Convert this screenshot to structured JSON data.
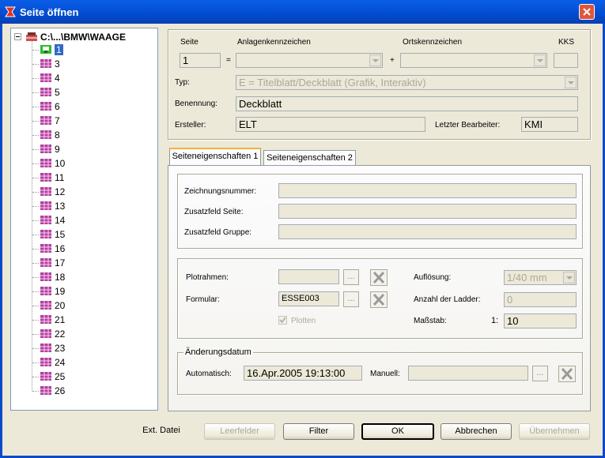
{
  "window": {
    "title": "Seite öffnen",
    "accent": "#0a5de6",
    "close_color": "#e0563b"
  },
  "tree": {
    "root_label": "C:\\...\\BMW\\WAAGE",
    "items": [
      "1",
      "3",
      "4",
      "5",
      "6",
      "7",
      "8",
      "9",
      "10",
      "11",
      "12",
      "13",
      "14",
      "15",
      "16",
      "17",
      "18",
      "19",
      "20",
      "21",
      "22",
      "23",
      "24",
      "25",
      "26"
    ],
    "selected": "1"
  },
  "header": {
    "seite_label": "Seite",
    "seite_value": "1",
    "anlage_label": "Anlagenkennzeichen",
    "eq_sign": "=",
    "plus_sign": "+",
    "ort_label": "Ortskennzeichen",
    "kks_label": "KKS",
    "typ_label": "Typ:",
    "typ_value": "E = Titelblatt/Deckblatt  (Grafik, Interaktiv)",
    "benennung_label": "Benennung:",
    "benennung_value": "Deckblatt",
    "ersteller_label": "Ersteller:",
    "ersteller_value": "ELT",
    "bearbeiter_label": "Letzter Bearbeiter:",
    "bearbeiter_value": "KMI"
  },
  "tabs": [
    {
      "label": "Seiteneigenschaften 1",
      "active": true
    },
    {
      "label": "Seiteneigenschaften 2",
      "active": false
    }
  ],
  "props": {
    "zeichnung_label": "Zeichnungsnummer:",
    "zusatz_seite_label": "Zusatzfeld Seite:",
    "zusatz_gruppe_label": "Zusatzfeld Gruppe:",
    "plotrahmen_label": "Plotrahmen:",
    "formular_label": "Formular:",
    "formular_value": "ESSE003",
    "plotten_label": "Plotten",
    "browse_label": "...",
    "aufloesung_label": "Auflösung:",
    "aufloesung_value": "1/40 mm",
    "ladder_label": "Anzahl der Ladder:",
    "ladder_value": "0",
    "massstab_label": "Maßstab:",
    "massstab_prefix": "1:",
    "massstab_value": "10"
  },
  "aenderung": {
    "group_label": "Änderungsdatum",
    "auto_label": "Automatisch:",
    "auto_value": "16.Apr.2005 19:13:00",
    "manuell_label": "Manuell:"
  },
  "buttons": {
    "ext_datei": "Ext. Datei",
    "leerfelder": "Leerfelder",
    "filter": "Filter",
    "ok": "OK",
    "abbrechen": "Abbrechen",
    "uebernehmen": "Übernehmen"
  }
}
